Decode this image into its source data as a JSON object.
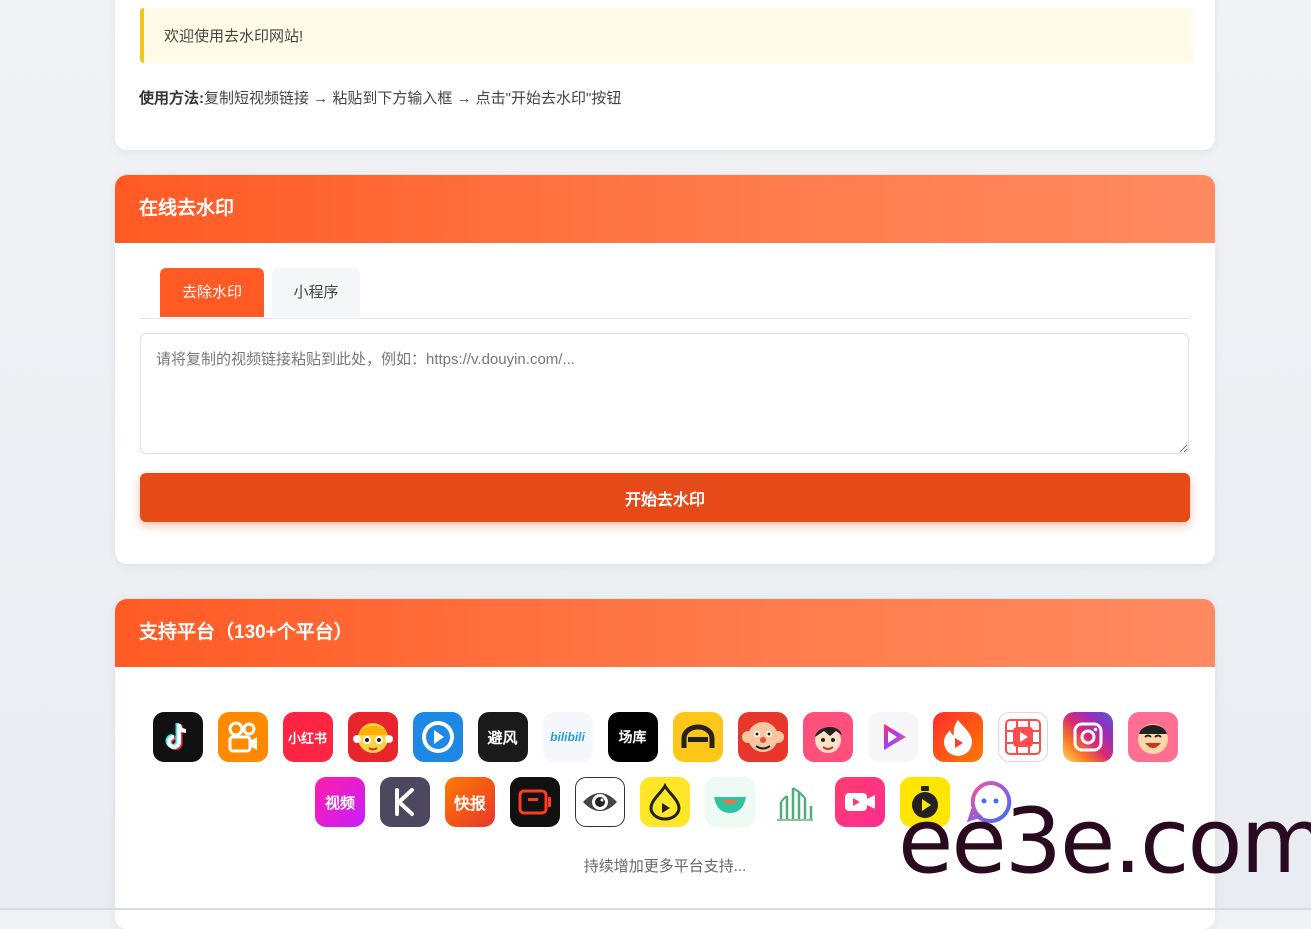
{
  "intro": {
    "notice": "欢迎使用去水印网站!",
    "usage_label": "使用方法:",
    "usage_text": "复制短视频链接 → 粘贴到下方输入框 → 点击\"开始去水印\"按钮"
  },
  "tool": {
    "title": "在线去水印",
    "tabs": [
      "去除水印",
      "小程序"
    ],
    "placeholder": "请将复制的视频链接粘贴到此处，例如：https://v.douyin.com/...",
    "submit_label": "开始去水印"
  },
  "platforms": {
    "title": "支持平台（130+个平台）",
    "icons_row1": [
      "douyin-icon",
      "kuaishou-icon",
      "xiaohongshu-icon",
      "manga-icon",
      "video-play-icon",
      "bifeng-icon",
      "bilibili-icon",
      "changku-icon",
      "car-icon",
      "monkey-icon",
      "cartoon-boy-icon",
      "play-triangle-icon",
      "huoshan-icon",
      "red-grid-icon",
      "instagram-icon",
      "laugh-face-icon"
    ],
    "icons_row2": [
      "shipin-icon",
      "k-icon",
      "kuaibao-icon",
      "video-frame-icon",
      "eye-icon",
      "pear-play-icon",
      "bowl-icon",
      "bamboo-icon",
      "video-camera-icon",
      "stopwatch-play-icon",
      "chat-bot-icon"
    ],
    "text_xhs": "小红书",
    "text_bifeng": "避风",
    "text_bili": "bilibili",
    "text_changku": "场库",
    "text_shipin": "视频",
    "text_kuaibao": "快报",
    "more": "持续增加更多平台支持..."
  },
  "watermark": "ee3e.com"
}
